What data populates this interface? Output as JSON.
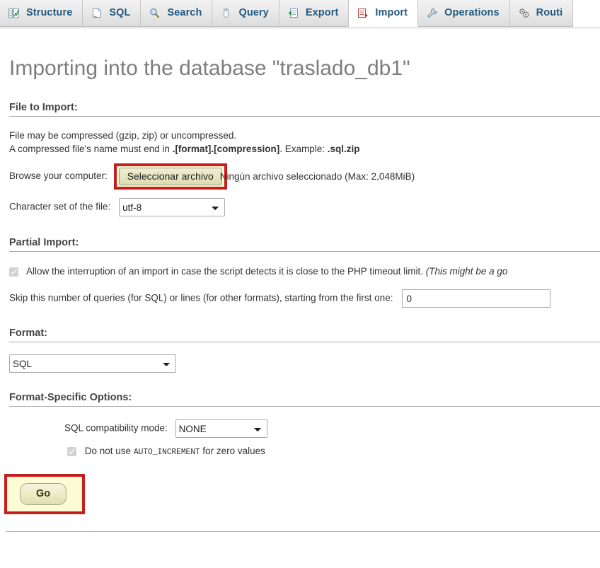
{
  "tabs": [
    {
      "id": "structure",
      "label": "Structure",
      "icon": "structure-icon",
      "active": false
    },
    {
      "id": "sql",
      "label": "SQL",
      "icon": "sql-icon",
      "active": false
    },
    {
      "id": "search",
      "label": "Search",
      "icon": "search-icon",
      "active": false
    },
    {
      "id": "query",
      "label": "Query",
      "icon": "query-icon",
      "active": false
    },
    {
      "id": "export",
      "label": "Export",
      "icon": "export-icon",
      "active": false
    },
    {
      "id": "import",
      "label": "Import",
      "icon": "import-icon",
      "active": true
    },
    {
      "id": "operations",
      "label": "Operations",
      "icon": "wrench-icon",
      "active": false
    },
    {
      "id": "routines",
      "label": "Routi",
      "icon": "routines-icon",
      "active": false
    }
  ],
  "page": {
    "title": "Importing into the database \"traslado_db1\""
  },
  "file_to_import": {
    "legend": "File to Import:",
    "note_line1": "File may be compressed (gzip, zip) or uncompressed.",
    "note_line2_pre": "A compressed file's name must end in ",
    "note_line2_bold1": ".[format].[compression]",
    "note_line2_mid": ". Example: ",
    "note_line2_bold2": ".sql.zip",
    "browse_label": "Browse your computer:",
    "file_button_label": "Seleccionar archivo",
    "file_status": "Ningún archivo seleccionado (Max: 2,048MiB)",
    "charset_label": "Character set of the file:",
    "charset_value": "utf-8",
    "charset_options": [
      "utf-8"
    ]
  },
  "partial_import": {
    "legend": "Partial Import:",
    "allow_checkbox_checked": true,
    "allow_label": "Allow the interruption of an import in case the script detects it is close to the PHP timeout limit.",
    "allow_note": "(This might be a go",
    "skip_label": "Skip this number of queries (for SQL) or lines (for other formats), starting from the first one:",
    "skip_value": "0"
  },
  "format": {
    "legend": "Format:",
    "value": "SQL",
    "options": [
      "SQL"
    ]
  },
  "format_specific": {
    "legend": "Format-Specific Options:",
    "compat_label": "SQL compatibility mode:",
    "compat_value": "NONE",
    "compat_options": [
      "NONE"
    ],
    "auto_inc_checked": true,
    "auto_inc_pre": "Do not use ",
    "auto_inc_code": "AUTO_INCREMENT",
    "auto_inc_post": " for zero values"
  },
  "submit": {
    "go_label": "Go"
  },
  "colors": {
    "highlight_border": "#c81d1d",
    "highlight_fill": "#fbfbd6",
    "tab_link": "#235a81",
    "title_grey": "#7d7d7d"
  }
}
